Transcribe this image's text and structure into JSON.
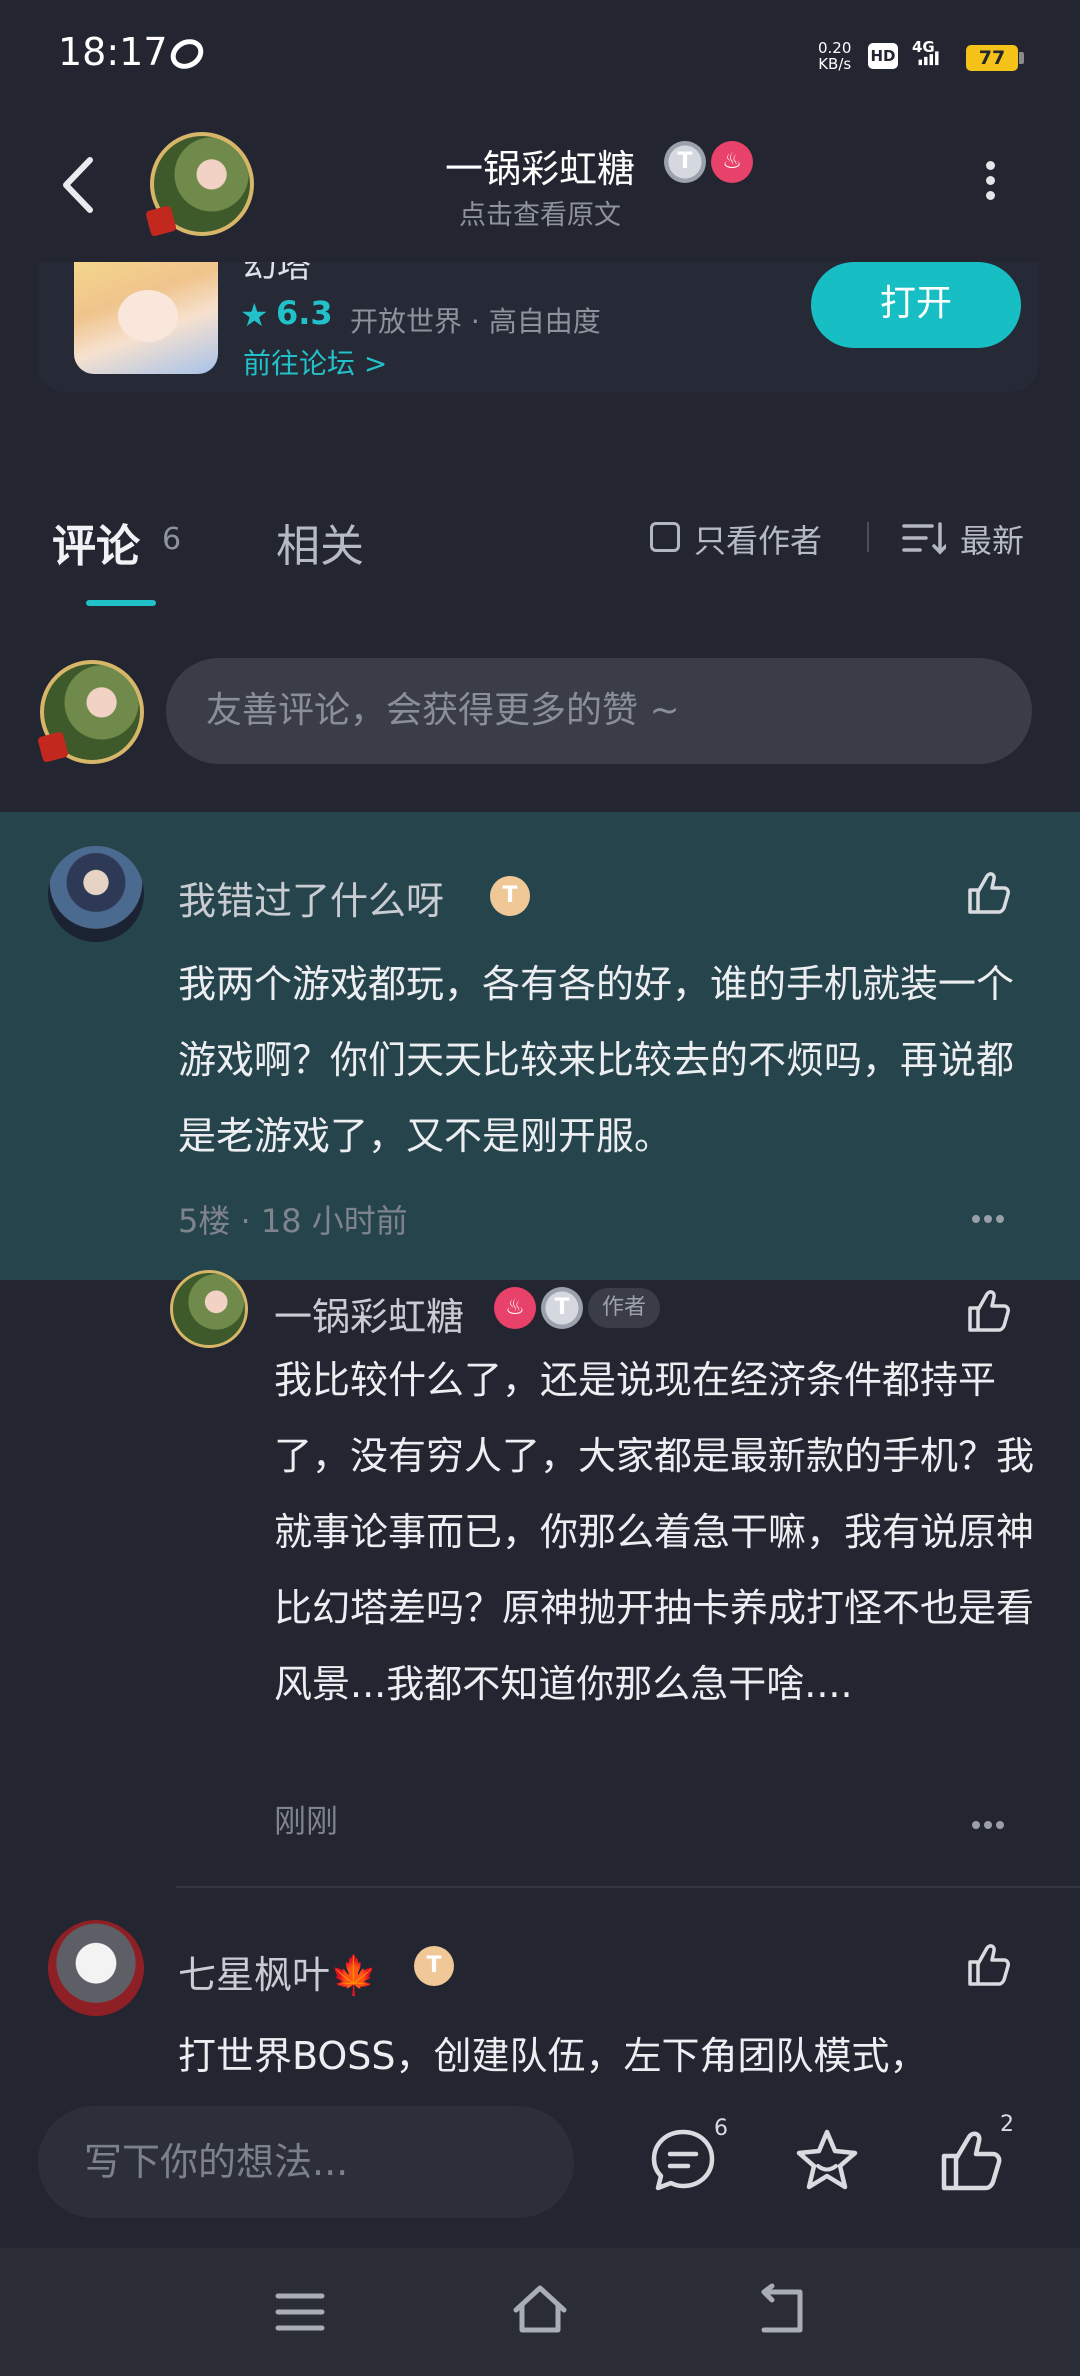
{
  "status_bar": {
    "time": "18:17",
    "net_speed_value": "0.20",
    "net_speed_unit": "KB/s",
    "hd_label": "HD",
    "network_label": "4G",
    "battery": "77"
  },
  "header": {
    "title": "一锅彩虹糖",
    "subtitle": "点击查看原文",
    "badge_t": "T"
  },
  "game_card": {
    "name": "幻塔",
    "rating": "6.3",
    "tags": "开放世界 · 高自由度",
    "forum_link": "前往论坛 >",
    "open_button": "打开"
  },
  "tabs": {
    "comments_label": "评论",
    "comments_count": "6",
    "related_label": "相关",
    "only_author_label": "只看作者",
    "sort_label": "最新"
  },
  "comment_input": {
    "placeholder": "友善评论，会获得更多的赞 ~"
  },
  "comments": [
    {
      "username": "我错过了什么呀",
      "badge": "T",
      "body": "我两个游戏都玩，各有各的好，谁的手机就装一个游戏啊？你们天天比较来比较去的不烦吗，再说都是老游戏了，又不是刚开服。",
      "meta": "5楼 · 18 小时前",
      "reply": {
        "username": "一锅彩虹糖",
        "author_tag": "作者",
        "body": "我比较什么了，还是说现在经济条件都持平了，没有穷人了，大家都是最新款的手机？我就事论事而已，你那么着急干嘛，我有说原神比幻塔差吗？原神抛开抽卡养成打怪不也是看风景...我都不知道你那么急干啥....",
        "meta": "刚刚"
      }
    },
    {
      "username": "七星枫叶🍁",
      "badge": "T",
      "body": "打世界BOSS，创建队伍，左下角团队模式，"
    }
  ],
  "bottom_bar": {
    "input_placeholder": "写下你的想法...",
    "comment_count": "6",
    "like_count": "2"
  },
  "colors": {
    "background": "#232530",
    "accent": "#17bfc4",
    "highlight": "#26444b"
  }
}
